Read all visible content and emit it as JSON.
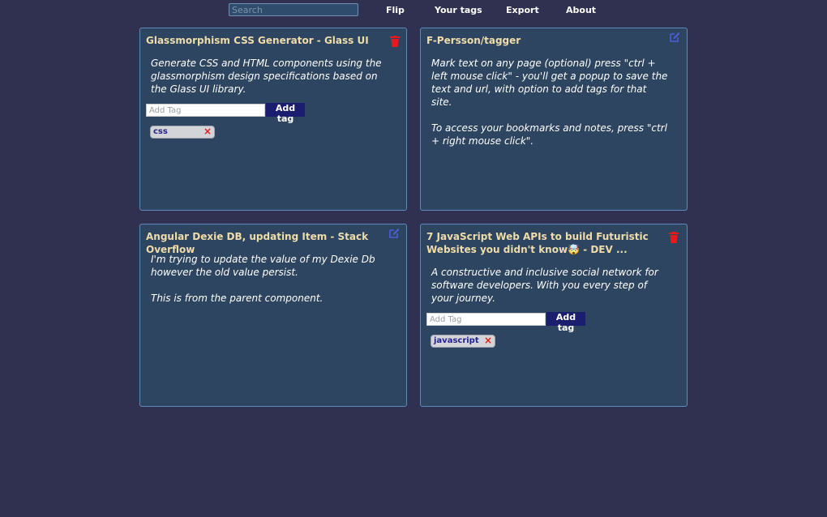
{
  "nav": {
    "search_placeholder": "Search",
    "links": [
      "Flip",
      "Your tags",
      "Export",
      "About"
    ]
  },
  "cards": [
    {
      "title": "Glassmorphism CSS Generator - Glass UI",
      "description": "Generate CSS and HTML components using the glassmorphism design specifications based on the Glass UI library.",
      "action_icon": "trash-icon",
      "tag_input_placeholder": "Add Tag",
      "add_tag_label": "Add tag",
      "tags": [
        "css"
      ]
    },
    {
      "title": "F-Persson/tagger",
      "description": "Mark text on any page (optional) press \"ctrl + left mouse click\" - you'll get a popup to save the text and url, with option to add tags for that site.\n\nTo access your bookmarks and notes, press \"ctrl + right mouse click\".",
      "action_icon": "edit-icon",
      "tags": []
    },
    {
      "title": "Angular Dexie DB, updating Item - Stack Overflow",
      "description": "I'm trying to update the value of my Dexie Db however the old value persist.\n\nThis is from the parent component.",
      "action_icon": "edit-icon",
      "tags": []
    },
    {
      "title": "7 JavaScript Web APIs to build Futuristic Websites you didn't know🤯 - DEV ...",
      "description": "A constructive and inclusive social network for software developers. With you every step of your journey.",
      "action_icon": "trash-icon",
      "tag_input_placeholder": "Add Tag",
      "add_tag_label": "Add tag",
      "tags": [
        "javascript"
      ]
    }
  ],
  "colors": {
    "background": "#303150",
    "card": "#2d4561",
    "card_border": "#5d89bb",
    "title": "#f0dca9",
    "trash": "#e31b1b",
    "edit": "#4b5fd8",
    "button": "#1b1d6e"
  }
}
